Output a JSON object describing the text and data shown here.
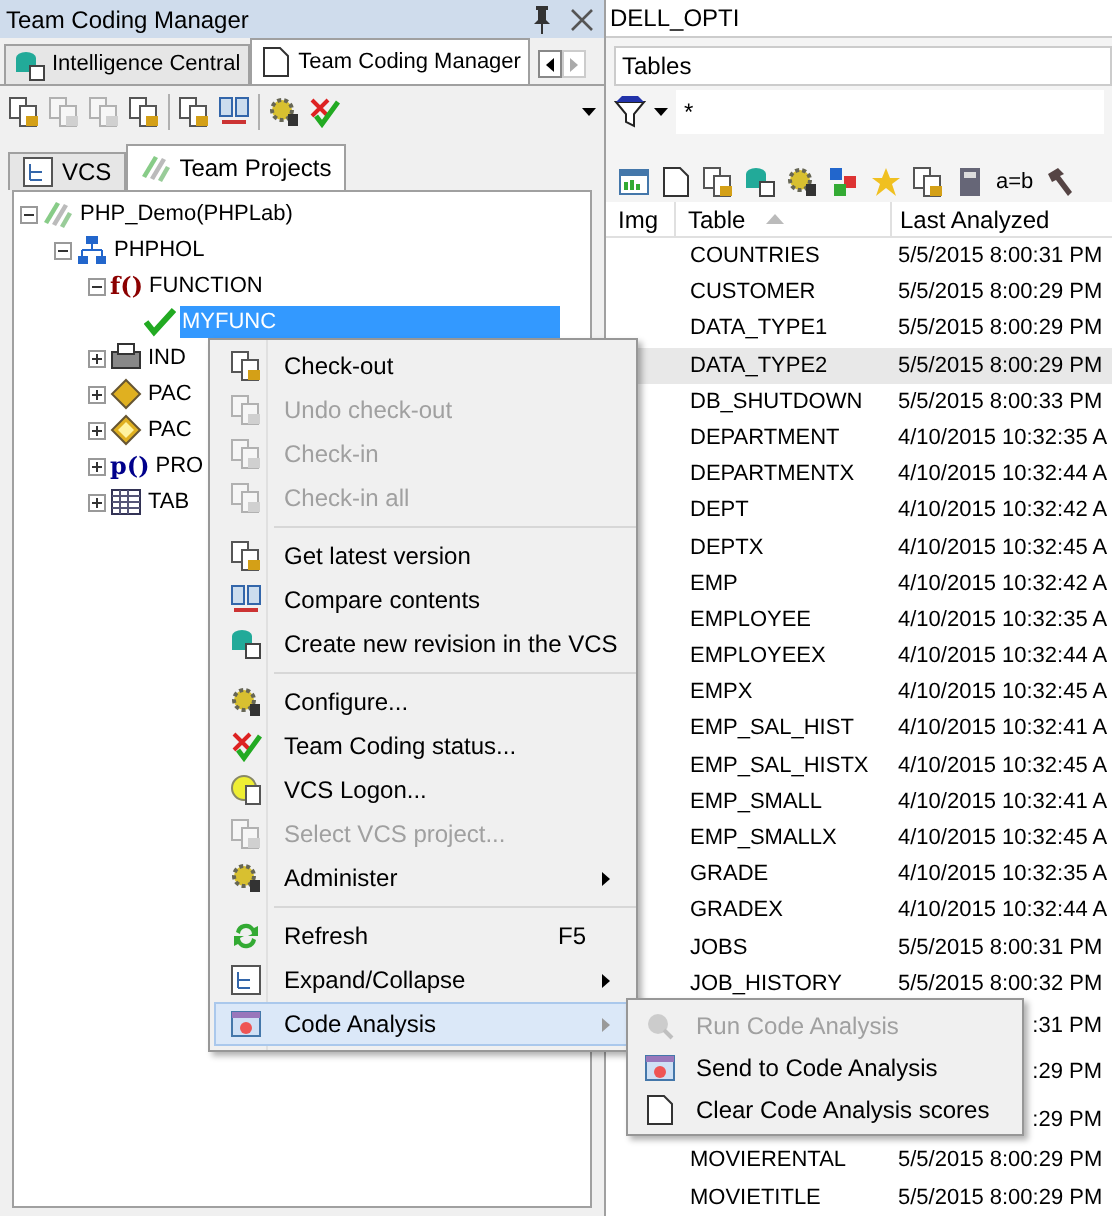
{
  "left_panel": {
    "title": "Team Coding Manager",
    "tabs": [
      {
        "label": "Intelligence Central",
        "selected": false
      },
      {
        "label": "Team Coding Manager",
        "selected": true
      }
    ],
    "toolbar": [
      {
        "kind": "button",
        "disabled": false
      },
      {
        "kind": "button",
        "disabled": true
      },
      {
        "kind": "button",
        "disabled": true
      },
      {
        "kind": "button",
        "disabled": false
      },
      {
        "kind": "separator"
      },
      {
        "kind": "button",
        "disabled": false
      },
      {
        "kind": "button",
        "disabled": false
      },
      {
        "kind": "separator"
      },
      {
        "kind": "button",
        "disabled": false
      },
      {
        "kind": "button",
        "disabled": false
      }
    ],
    "subtabs": [
      {
        "label": "VCS",
        "selected": false
      },
      {
        "label": "Team Projects",
        "selected": true
      }
    ],
    "tree": [
      {
        "kind": "project",
        "label": "PHP_Demo(PHPLab)",
        "expanded": true,
        "selected": false,
        "children": [
          {
            "kind": "schema",
            "label": "PHPHOL",
            "expanded": true,
            "selected": false,
            "children": [
              {
                "kind": "function",
                "glyph": "f()",
                "label": "FUNCTION",
                "expanded": true,
                "selected": false,
                "children": [
                  {
                    "kind": "checked",
                    "label": "MYFUNC",
                    "selected": true
                  }
                ]
              },
              {
                "kind": "index",
                "label": "IND",
                "expanded": false,
                "selected": false
              },
              {
                "kind": "package",
                "label": "PAC",
                "expanded": false,
                "selected": false
              },
              {
                "kind": "package_body",
                "label": "PAC",
                "expanded": false,
                "selected": false
              },
              {
                "kind": "procedure",
                "glyph": "p()",
                "label": "PRO",
                "expanded": false,
                "selected": false
              },
              {
                "kind": "table",
                "label": "TAB",
                "expanded": false,
                "selected": false
              }
            ]
          }
        ]
      }
    ]
  },
  "right_panel": {
    "connection": "DELL_OPTI",
    "object_type": "Tables",
    "filter": "*",
    "toolbar": [
      {
        "kind": "icon"
      },
      {
        "kind": "icon"
      },
      {
        "kind": "icon"
      },
      {
        "kind": "icon"
      },
      {
        "kind": "icon"
      },
      {
        "kind": "icon"
      },
      {
        "kind": "icon"
      },
      {
        "kind": "icon"
      },
      {
        "kind": "icon"
      },
      {
        "kind": "text",
        "label": "a=b"
      },
      {
        "kind": "icon"
      }
    ],
    "table": {
      "columns": [
        "Img",
        "Table",
        "Last Analyzed"
      ],
      "rows": [
        {
          "table": "COUNTRIES",
          "analyzed": "5/5/2015 8:00:31 PM",
          "selected": false
        },
        {
          "table": "CUSTOMER",
          "analyzed": "5/5/2015 8:00:29 PM",
          "selected": false
        },
        {
          "table": "DATA_TYPE1",
          "analyzed": "5/5/2015 8:00:29 PM",
          "selected": false
        },
        {
          "table": "DATA_TYPE2",
          "analyzed": "5/5/2015 8:00:29 PM",
          "selected": true
        },
        {
          "table": "DB_SHUTDOWN",
          "analyzed": "5/5/2015 8:00:33 PM",
          "selected": false
        },
        {
          "table": "DEPARTMENT",
          "analyzed": "4/10/2015 10:32:35 A",
          "selected": false
        },
        {
          "table": "DEPARTMENTX",
          "analyzed": "4/10/2015 10:32:44 A",
          "selected": false
        },
        {
          "table": "DEPT",
          "analyzed": "4/10/2015 10:32:42 A",
          "selected": false
        },
        {
          "table": "DEPTX",
          "analyzed": "4/10/2015 10:32:45 A",
          "selected": false
        },
        {
          "table": "EMP",
          "analyzed": "4/10/2015 10:32:42 A",
          "selected": false
        },
        {
          "table": "EMPLOYEE",
          "analyzed": "4/10/2015 10:32:35 A",
          "selected": false
        },
        {
          "table": "EMPLOYEEX",
          "analyzed": "4/10/2015 10:32:44 A",
          "selected": false
        },
        {
          "table": "EMPX",
          "analyzed": "4/10/2015 10:32:45 A",
          "selected": false
        },
        {
          "table": "EMP_SAL_HIST",
          "analyzed": "4/10/2015 10:32:41 A",
          "selected": false
        },
        {
          "table": "EMP_SAL_HISTX",
          "analyzed": "4/10/2015 10:32:45 A",
          "selected": false
        },
        {
          "table": "EMP_SMALL",
          "analyzed": "4/10/2015 10:32:41 A",
          "selected": false
        },
        {
          "table": "EMP_SMALLX",
          "analyzed": "4/10/2015 10:32:45 A",
          "selected": false
        },
        {
          "table": "GRADE",
          "analyzed": "4/10/2015 10:32:35 A",
          "selected": false
        },
        {
          "table": "GRADEX",
          "analyzed": "4/10/2015 10:32:44 A",
          "selected": false
        },
        {
          "table": "JOBS",
          "analyzed": "5/5/2015 8:00:31 PM",
          "selected": false
        },
        {
          "table": "JOB_HISTORY",
          "analyzed": "5/5/2015 8:00:32 PM",
          "selected": false
        },
        {
          "analyzed": ":31 PM",
          "selected": false
        },
        {
          "analyzed": ":29 PM",
          "selected": false
        },
        {
          "analyzed": ":29 PM",
          "selected": false
        },
        {
          "table": "MOVIERENTAL",
          "analyzed": "5/5/2015 8:00:29 PM",
          "selected": false
        },
        {
          "table": "MOVIETITLE",
          "analyzed": "5/5/2015 8:00:29 PM",
          "selected": false
        }
      ]
    }
  },
  "context_menu": [
    {
      "kind": "item",
      "label": "Check-out",
      "disabled": false,
      "selected": false
    },
    {
      "kind": "item",
      "label": "Undo check-out",
      "disabled": true,
      "selected": false
    },
    {
      "kind": "item",
      "label": "Check-in",
      "disabled": true,
      "selected": false
    },
    {
      "kind": "item",
      "label": "Check-in all",
      "disabled": true,
      "selected": false
    },
    {
      "kind": "separator"
    },
    {
      "kind": "item",
      "label": "Get latest version",
      "disabled": false,
      "selected": false
    },
    {
      "kind": "item",
      "label": "Compare contents",
      "disabled": false,
      "selected": false
    },
    {
      "kind": "item",
      "label": "Create new revision in the VCS",
      "disabled": false,
      "selected": false
    },
    {
      "kind": "separator"
    },
    {
      "kind": "item",
      "label": "Configure...",
      "disabled": false,
      "selected": false
    },
    {
      "kind": "item",
      "label": "Team Coding status...",
      "disabled": false,
      "selected": false
    },
    {
      "kind": "item",
      "label": "VCS Logon...",
      "disabled": false,
      "selected": false
    },
    {
      "kind": "item",
      "label": "Select VCS project...",
      "disabled": true,
      "selected": false
    },
    {
      "kind": "item",
      "label": "Administer",
      "disabled": false,
      "selected": false,
      "submenu": true
    },
    {
      "kind": "separator"
    },
    {
      "kind": "item",
      "label": "Refresh",
      "disabled": false,
      "selected": false,
      "shortcut": "F5"
    },
    {
      "kind": "item",
      "label": "Expand/Collapse",
      "disabled": false,
      "selected": false,
      "submenu": true
    },
    {
      "kind": "item",
      "label": "Code Analysis",
      "disabled": false,
      "selected": true,
      "submenu": true
    }
  ],
  "submenu": [
    {
      "label": "Run Code Analysis",
      "disabled": true
    },
    {
      "label": "Send to Code Analysis",
      "disabled": false
    },
    {
      "label": "Clear Code Analysis scores",
      "disabled": false
    }
  ]
}
